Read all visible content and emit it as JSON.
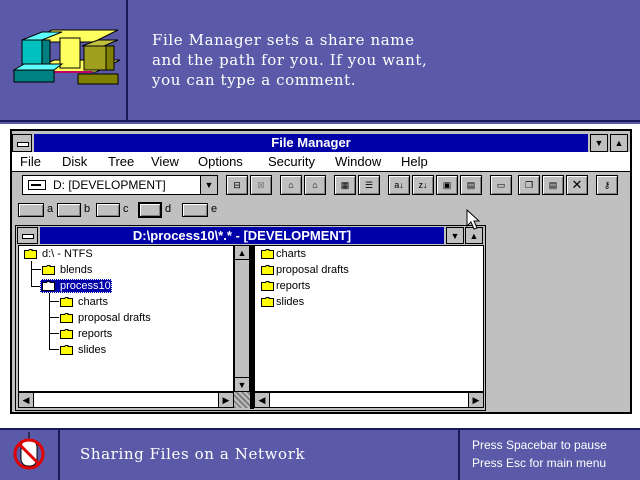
{
  "banner": {
    "lines": [
      "File Manager sets a share name",
      "and the path for you.  If you want,",
      "you can type a comment."
    ]
  },
  "file_manager": {
    "title": "File Manager",
    "menu": [
      "File",
      "Disk",
      "Tree",
      "View",
      "Options",
      "Security",
      "Window",
      "Help"
    ],
    "drive_select": "D: [DEVELOPMENT]",
    "drives": [
      "a",
      "b",
      "c",
      "d",
      "e"
    ],
    "child_window": {
      "title": "D:\\process10\\*.* - [DEVELOPMENT]",
      "tree": {
        "root": "d:\\ - NTFS",
        "items": [
          "blends",
          "process10"
        ],
        "subitems": [
          "charts",
          "proposal drafts",
          "reports",
          "slides"
        ]
      },
      "files": [
        "charts",
        "proposal drafts",
        "reports",
        "slides"
      ]
    }
  },
  "bottom_bar": {
    "title": "Sharing Files on a Network",
    "hint_pause": "Press Spacebar to pause",
    "hint_menu": "Press Esc for main menu"
  },
  "colors": {
    "banner_bg": "#5a5aa8",
    "title_bar": "#0000a8",
    "folder": "#ffff00",
    "selection": "#0000a8"
  },
  "icons": {
    "network": "network-computers-icon",
    "no_mouse": "no-mouse-icon",
    "folder": "folder-icon"
  }
}
